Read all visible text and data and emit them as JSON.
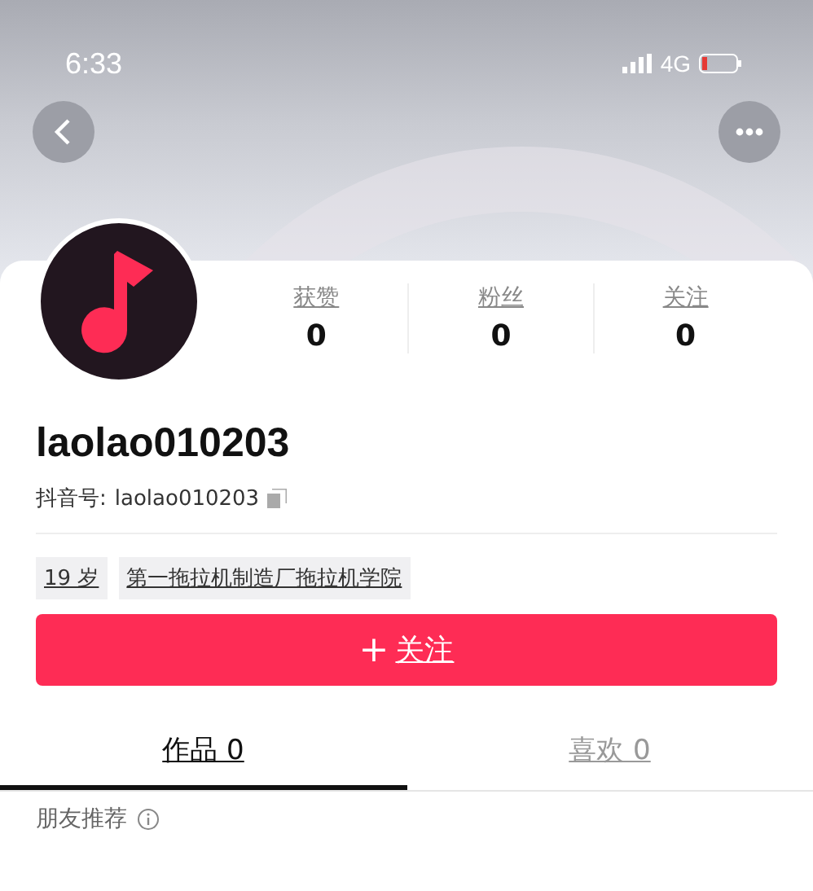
{
  "status_bar": {
    "time": "6:33",
    "network": "4G"
  },
  "profile": {
    "username": "laolao010203",
    "id_label": "抖音号:",
    "id_value": "laolao010203"
  },
  "stats": [
    {
      "label": "获赞",
      "value": "0"
    },
    {
      "label": "粉丝",
      "value": "0"
    },
    {
      "label": "关注",
      "value": "0"
    }
  ],
  "tags": [
    "19 岁",
    "第一拖拉机制造厂拖拉机学院"
  ],
  "follow_button": {
    "plus": "+",
    "label": "关注"
  },
  "tabs": [
    {
      "label": "作品 0",
      "selected": true
    },
    {
      "label": "喜欢 0",
      "selected": false
    }
  ],
  "section": {
    "title": "朋友推荐"
  }
}
